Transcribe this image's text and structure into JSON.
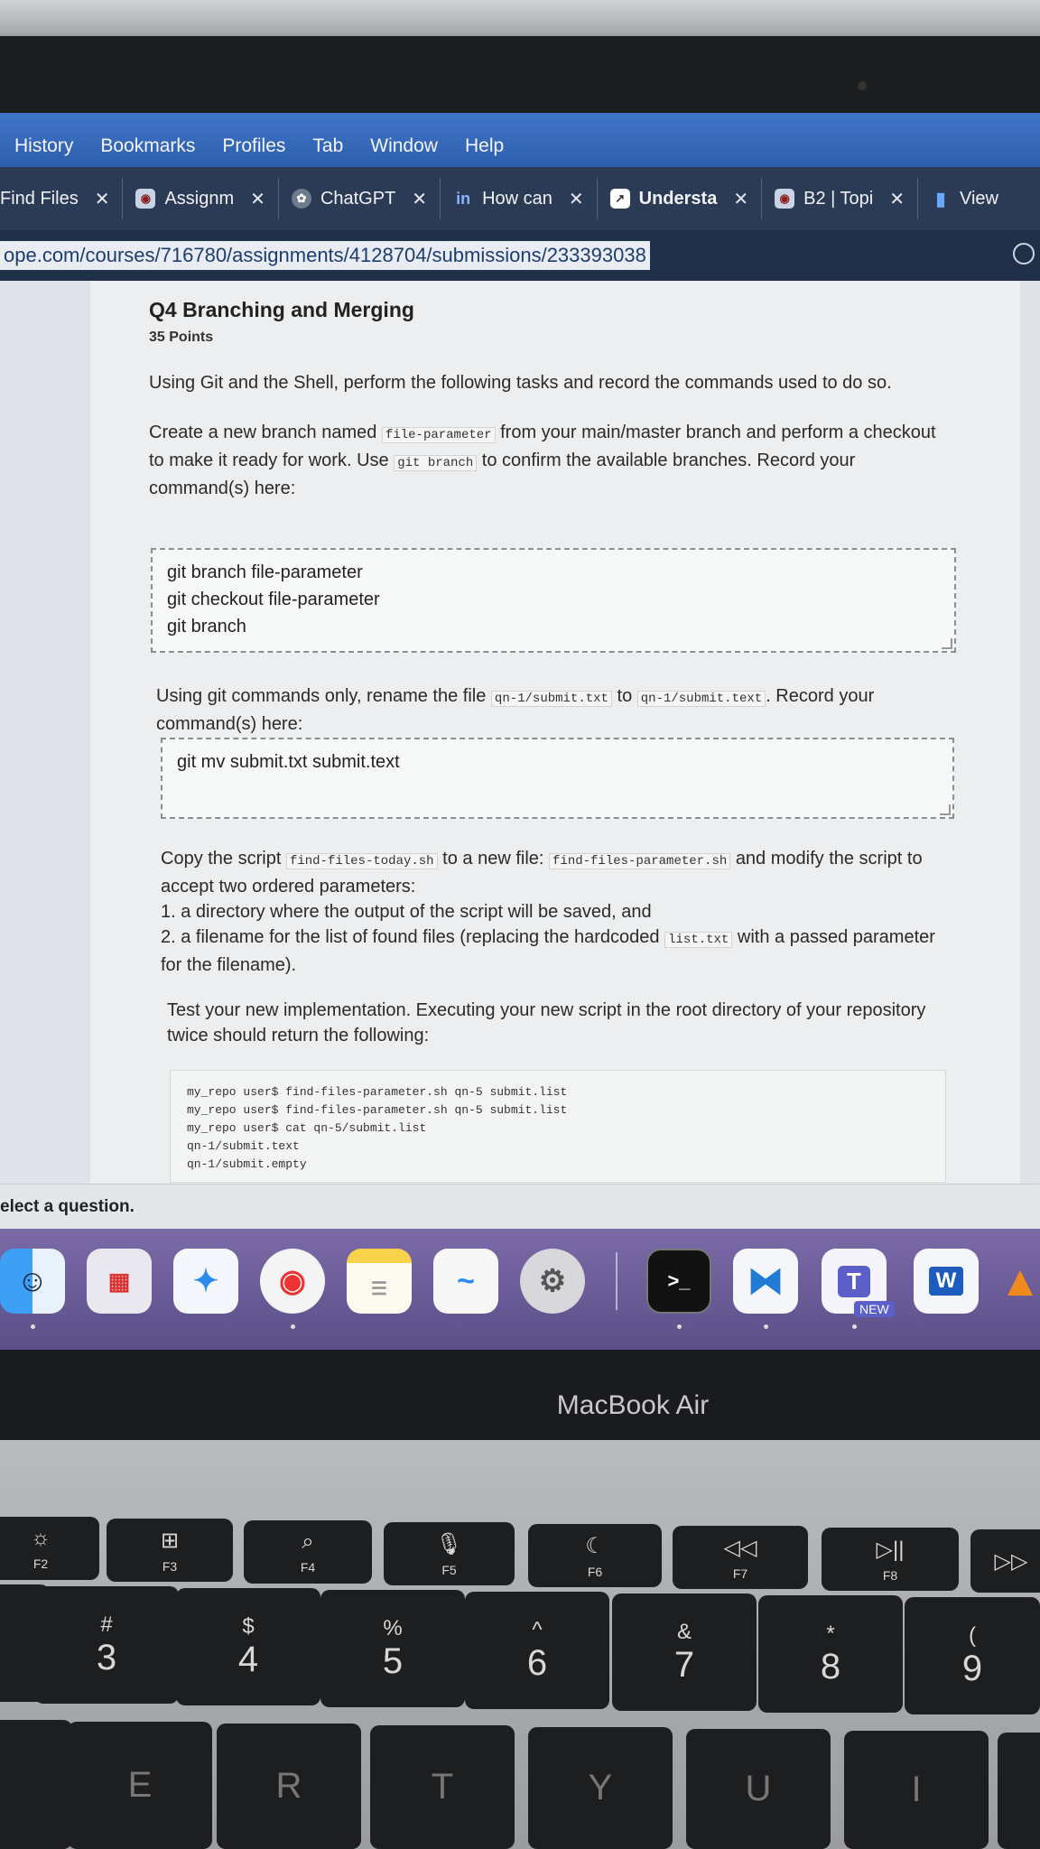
{
  "menubar": {
    "items": [
      "History",
      "Bookmarks",
      "Profiles",
      "Tab",
      "Window",
      "Help"
    ]
  },
  "tabs": [
    {
      "label": "Find Files",
      "icon": "file-icon"
    },
    {
      "label": "Assignm",
      "icon": "seal-icon"
    },
    {
      "label": "ChatGPT",
      "icon": "openai-icon"
    },
    {
      "label": "How can",
      "icon": "linkedin-icon"
    },
    {
      "label": "Understa",
      "icon": "chart-icon"
    },
    {
      "label": "B2 | Topi",
      "icon": "seal-icon"
    },
    {
      "label": "View",
      "icon": "bar-chart-icon"
    }
  ],
  "address_bar": {
    "url": "ope.com/courses/716780/assignments/4128704/submissions/233393038"
  },
  "question": {
    "title": "Q4 Branching and Merging",
    "points": "35 Points",
    "intro": "Using Git and the Shell, perform the following tasks and record the commands used to do so.",
    "task1": {
      "part1": "Create a new branch named",
      "code1": "file-parameter",
      "part2": "from your main/master branch and perform a checkout",
      "part3": "to make it ready for work. Use",
      "code2": "git branch",
      "part4": "to confirm the available branches. Record your",
      "part5": "command(s) here:",
      "answer": [
        "git branch file-parameter",
        "git checkout file-parameter",
        "git branch"
      ]
    },
    "task2": {
      "part1": "Using git commands only, rename the file",
      "code1": "qn-1/submit.txt",
      "part2": "to",
      "code2": "qn-1/submit.text",
      "part3": ". Record your",
      "part4": "command(s) here:",
      "answer": [
        "git mv submit.txt submit.text"
      ]
    },
    "task3": {
      "part1": "Copy the script",
      "code1": "find-files-today.sh",
      "part2": "to a new file:",
      "code2": "find-files-parameter.sh",
      "part3": "and modify the script to",
      "line2": "accept two ordered parameters:",
      "line3": "1. a directory where the output of the script will be saved, and",
      "line4a": "2. a filename for the list of found files (replacing the hardcoded",
      "code3": "list.txt",
      "line4b": "with a passed parameter",
      "line5": "for the filename)."
    },
    "task4": {
      "line1": "Test your new implementation. Executing your new script in the root directory of your repository",
      "line2": "twice should return the following:",
      "code_lines": [
        "my_repo user$ find-files-parameter.sh qn-5 submit.list",
        "my_repo user$ find-files-parameter.sh qn-5 submit.list",
        "my_repo user$ cat qn-5/submit.list",
        "qn-1/submit.text",
        "qn-1/submit.empty"
      ]
    }
  },
  "status": {
    "text": "elect a question."
  },
  "dock": {
    "apps": [
      "finder",
      "launchpad",
      "safari",
      "chrome",
      "notes",
      "freeform",
      "system-settings",
      "terminal",
      "vscode",
      "teams",
      "word",
      "vlc"
    ],
    "teams_badge": "NEW",
    "word_letter": "W",
    "teams_letter": "T",
    "terminal_prompt": ">_"
  },
  "laptop": {
    "brand": "MacBook Air"
  },
  "keyboard": {
    "fn_row": [
      {
        "sym": "☼",
        "label": "F2"
      },
      {
        "sym": "⊞",
        "label": "F3"
      },
      {
        "sym": "⌕",
        "label": "F4"
      },
      {
        "sym": "🎙",
        "label": "F5"
      },
      {
        "sym": "☾",
        "label": "F6"
      },
      {
        "sym": "◁◁",
        "label": "F7"
      },
      {
        "sym": "▷||",
        "label": "F8"
      }
    ],
    "num_row": [
      {
        "top": "#",
        "bottom": "3"
      },
      {
        "top": "$",
        "bottom": "4"
      },
      {
        "top": "%",
        "bottom": "5"
      },
      {
        "top": "^",
        "bottom": "6"
      },
      {
        "top": "&",
        "bottom": "7"
      },
      {
        "top": "*",
        "bottom": "8"
      },
      {
        "top": "(",
        "bottom": "9"
      }
    ],
    "letter_row": [
      "E",
      "R",
      "T",
      "Y",
      "U",
      "I"
    ]
  }
}
